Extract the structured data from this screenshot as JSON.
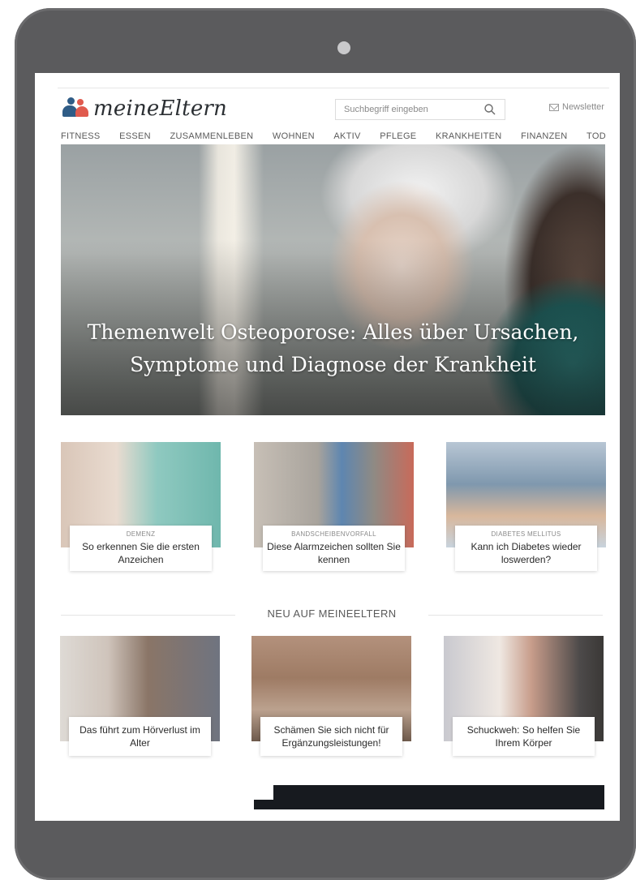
{
  "header": {
    "logo_text": "meineEltern",
    "search_placeholder": "Suchbegriff eingeben",
    "newsletter_label": "Newsletter"
  },
  "nav": [
    "FITNESS",
    "ESSEN",
    "ZUSAMMENLEBEN",
    "WOHNEN",
    "AKTIV",
    "PFLEGE",
    "KRANKHEITEN",
    "FINANZEN",
    "TOD"
  ],
  "hero": {
    "title_line1": "Themenwelt Osteoporose: Alles über Ursachen,",
    "title_line2": "Symptome und Diagnose der Krankheit"
  },
  "featured": [
    {
      "category": "DEMENZ",
      "title": "So erkennen Sie die ersten Anzeichen"
    },
    {
      "category": "BANDSCHEIBENVORFALL",
      "title": "Diese Alarmzeichen sollten Sie kennen"
    },
    {
      "category": "DIABETES MELLITUS",
      "title": "Kann ich Diabetes wieder loswerden?"
    }
  ],
  "section_new": {
    "heading": "NEU AUF MEINEELTERN",
    "items": [
      {
        "title": "Das führt zum Hörverlust im Alter"
      },
      {
        "title": "Schämen Sie sich nicht für Ergänzungsleistungen!"
      },
      {
        "title": "Schuckweh: So helfen Sie Ihrem Körper"
      }
    ]
  },
  "icons": {
    "search": "search-icon",
    "newsletter": "envelope-icon",
    "camera": "camera-icon"
  },
  "colors": {
    "frame": "#5b5b5d",
    "logo_blue": "#2f5c86",
    "logo_red": "#e05a4e"
  }
}
